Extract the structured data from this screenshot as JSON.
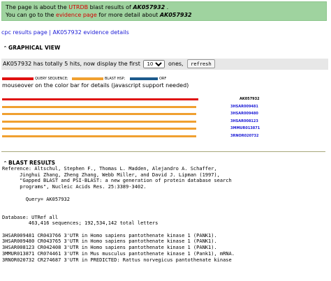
{
  "notice": {
    "line1_pre": "The page is about the ",
    "line1_link": "UTRDB",
    "line1_mid": " blast results of ",
    "line1_id": "AK057932",
    "line1_post": " .",
    "line2_pre": "You can go to the ",
    "line2_link": "evidence page",
    "line2_mid": " for more detail about ",
    "line2_id": "AK057932"
  },
  "toplinks": {
    "cpc": "cpc results page",
    "sep": "|",
    "evidence": "AK057932 evidence details"
  },
  "graphical": {
    "title": "GRAPHICAL VIEW",
    "hits_text": "AK057932 has totally 5 hits, now display the first",
    "select_value": "10",
    "ones": "ones,",
    "refresh": "refresh",
    "legend": {
      "query": "QUERY SEQUENCE;",
      "hsp": "BLAST HSP;",
      "orf": "ORF"
    },
    "legend_colors": {
      "query": "#e01010",
      "hsp": "#f0a030",
      "orf": "#1c5a8c"
    },
    "mouseover": "mouseover on the color bar for details (javascript support needed)",
    "hits": [
      {
        "label": "AK057932",
        "color": "#e01010"
      },
      {
        "label": "3HSAR009481",
        "color": "#f0a030"
      },
      {
        "label": "3HSAR009480",
        "color": "#f0a030"
      },
      {
        "label": "3HSAR008123",
        "color": "#f0a030"
      },
      {
        "label": "3MMUR013871",
        "color": "#f0a030"
      },
      {
        "label": "3RNOR020732",
        "color": "#f0a030"
      }
    ]
  },
  "blast": {
    "title": "BLAST RESULTS",
    "text": "Reference: Altschul, Stephen F., Thomas L. Madden, Alejandro A. Schaffer,\n      Jinghui Zhang, Zheng Zhang, Webb Miller, and David J. Lipman (1997),\n      \"Gapped BLAST and PSI-BLAST: a new generation of protein database search\n      programs\", Nucleic Acids Res. 25:3389-3402.\n\n        Query= AK057932\n\n\nDatabase: UTRef all\n         463,416 sequences; 192,534,142 total letters\n\n3HSAR009481 CR043766 3'UTR in Homo sapiens pantothenate kinase 1 (PANK1).\n3HSAR009480 CR043765 3'UTR in Homo sapiens pantothenate kinase 1 (PANK1).\n3HSAR008123 CR042408 3'UTR in Homo sapiens pantothenate kinase 1 (PANK1).\n3MMUR013871 CR074461 3'UTR in Mus musculus pantothenate kinase 1 (Pank1), mRNA.\n3RNOR020732 CR274687 3'UTR in PREDICTED: Rattus norvegicus pantothenate kinase"
  }
}
